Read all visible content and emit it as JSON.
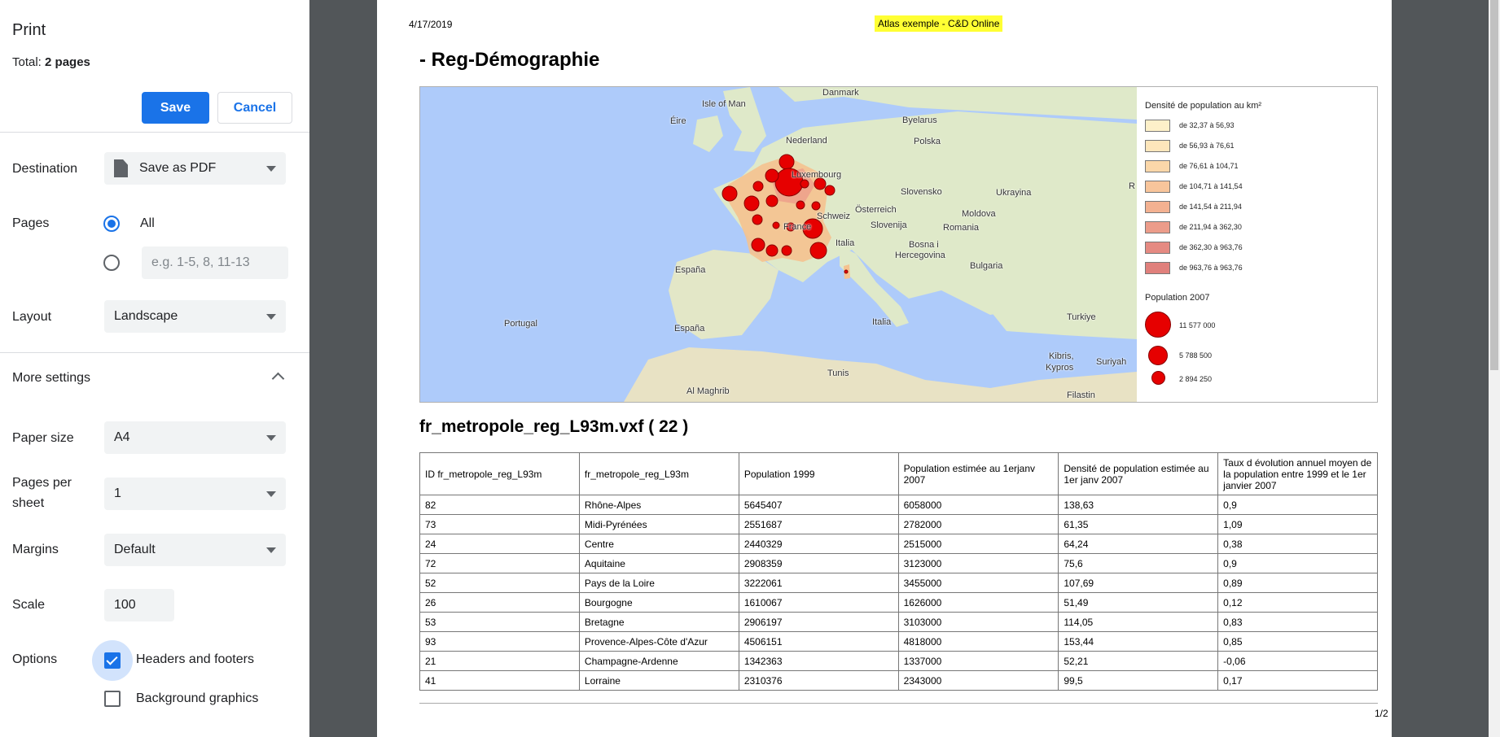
{
  "dialog": {
    "title": "Print",
    "total_label": "Total: ",
    "total_value": "2 pages",
    "save_label": "Save",
    "cancel_label": "Cancel",
    "destination_label": "Destination",
    "destination_value": "Save as PDF",
    "pages_label": "Pages",
    "pages_all_label": "All",
    "pages_custom_placeholder": "e.g. 1-5, 8, 11-13",
    "layout_label": "Layout",
    "layout_value": "Landscape",
    "more_settings_label": "More settings",
    "paper_size_label": "Paper size",
    "paper_size_value": "A4",
    "pages_per_sheet_label_1": "Pages per",
    "pages_per_sheet_label_2": "sheet",
    "pages_per_sheet_value": "1",
    "margins_label": "Margins",
    "margins_value": "Default",
    "scale_label": "Scale",
    "scale_value": "100",
    "options_label": "Options",
    "headers_footers_label": "Headers and footers",
    "background_graphics_label": "Background graphics"
  },
  "preview": {
    "header_date": "4/17/2019",
    "header_title": "Atlas exemple - C&D Online",
    "page_title": "- Reg-Démographie",
    "section_title": "fr_metropole_reg_L93m.vxf ( 22 )",
    "page_number": "1/2"
  },
  "map": {
    "labels": [
      "Danmark",
      "Isle of Man",
      "Éire",
      "Nederland",
      "Byelarus",
      "Polska",
      "Luxembourg",
      "Slovensko",
      "Ukrayina",
      "R",
      "Österreich",
      "Moldova",
      "Schweiz",
      "Slovenija",
      "Romania",
      "France",
      "Bosna i",
      "Hercegovina",
      "Italia",
      "Bulgaria",
      "España",
      "Portugal",
      "España",
      "Italia",
      "Turkiye",
      "Kibris,",
      "Kypros",
      "Suriyah",
      "Tunis",
      "Al Maghrib",
      "Filastin"
    ],
    "legend": {
      "density_title": "Densité de population au km²",
      "density_classes": [
        {
          "label": "de 32,37 à 56,93",
          "color": "#fdf0c9"
        },
        {
          "label": "de 56,93 à 76,61",
          "color": "#fde6bb"
        },
        {
          "label": "de 76,61 à 104,71",
          "color": "#fbd7a9"
        },
        {
          "label": "de 104,71 à 141,54",
          "color": "#f8c59b"
        },
        {
          "label": "de 141,54 à 211,94",
          "color": "#f3b191"
        },
        {
          "label": "de 211,94 à 362,30",
          "color": "#ec9c8a"
        },
        {
          "label": "de 362,30 à 963,76",
          "color": "#e58a82"
        },
        {
          "label": "de 963,76 à 963,76",
          "color": "#e0807c"
        }
      ],
      "population_title": "Population 2007",
      "population_classes": [
        {
          "label": "11 577 000",
          "size": "large"
        },
        {
          "label": "5 788 500",
          "size": "medium"
        },
        {
          "label": "2 894 250",
          "size": "small"
        }
      ]
    }
  },
  "table": {
    "headers": [
      "ID fr_metropole_reg_L93m",
      "fr_metropole_reg_L93m",
      "Population 1999",
      "Population estimée au 1erjanv 2007",
      "Densité de population estimée au 1er janv 2007",
      "Taux d évolution annuel moyen de la population entre 1999 et le 1er janvier 2007"
    ],
    "rows": [
      [
        "82",
        "Rhône-Alpes",
        "5645407",
        "6058000",
        "138,63",
        "0,9"
      ],
      [
        "73",
        "Midi-Pyrénées",
        "2551687",
        "2782000",
        "61,35",
        "1,09"
      ],
      [
        "24",
        "Centre",
        "2440329",
        "2515000",
        "64,24",
        "0,38"
      ],
      [
        "72",
        "Aquitaine",
        "2908359",
        "3123000",
        "75,6",
        "0,9"
      ],
      [
        "52",
        "Pays de la Loire",
        "3222061",
        "3455000",
        "107,69",
        "0,89"
      ],
      [
        "26",
        "Bourgogne",
        "1610067",
        "1626000",
        "51,49",
        "0,12"
      ],
      [
        "53",
        "Bretagne",
        "2906197",
        "3103000",
        "114,05",
        "0,83"
      ],
      [
        "93",
        "Provence-Alpes-Côte d'Azur",
        "4506151",
        "4818000",
        "153,44",
        "0,85"
      ],
      [
        "21",
        "Champagne-Ardenne",
        "1342363",
        "1337000",
        "52,21",
        "-0,06"
      ],
      [
        "41",
        "Lorraine",
        "2310376",
        "2343000",
        "99,5",
        "0,17"
      ]
    ]
  },
  "colors": {
    "accent": "#1a73e8",
    "highlight": "#ffff33",
    "bubble": "#e60000",
    "sea": "#aecbfa",
    "land": "#dfe9c9"
  },
  "icons": [
    "pdf-file-icon",
    "caret-down-icon",
    "chevron-up-icon",
    "checkmark-icon"
  ]
}
